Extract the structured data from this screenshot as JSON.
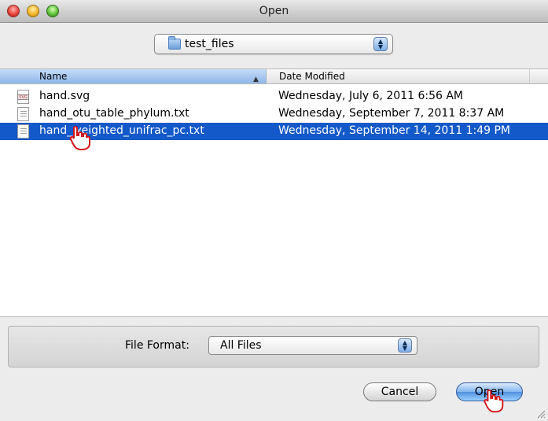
{
  "window": {
    "title": "Open"
  },
  "location": {
    "folder": "test_files",
    "icon": "folder-icon"
  },
  "columns": {
    "name": "Name",
    "date": "Date Modified"
  },
  "files": [
    {
      "name": "hand.svg",
      "date": "Wednesday, July 6, 2011 6:56 AM",
      "icon": "svg-file-icon",
      "selected": false
    },
    {
      "name": "hand_otu_table_phylum.txt",
      "date": "Wednesday, September 7, 2011 8:37 AM",
      "icon": "text-file-icon",
      "selected": false
    },
    {
      "name": "hand_weighted_unifrac_pc.txt",
      "date": "Wednesday, September 14, 2011 1:49 PM",
      "icon": "text-file-icon",
      "selected": true
    }
  ],
  "format": {
    "label": "File Format:",
    "value": "All Files"
  },
  "buttons": {
    "cancel": "Cancel",
    "open": "Open"
  },
  "colors": {
    "selection": "#1459c9",
    "cursor": "#d4141a"
  }
}
